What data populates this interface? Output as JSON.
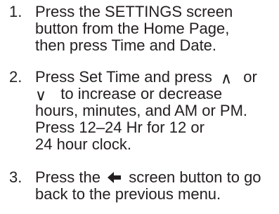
{
  "steps": [
    {
      "number": "1.",
      "lines": [
        "Press the SETTINGS screen",
        "button from the Home Page,",
        "then press Time and Date."
      ]
    },
    {
      "number": "2.",
      "line1_a": "Press Set Time and press",
      "line1_b": "or",
      "line2_b": "to increase or decrease",
      "lines_rest": [
        "hours, minutes, and AM or PM.",
        "Press 12–24 Hr for 12 or",
        "24 hour clock."
      ],
      "up_symbol": "∧",
      "down_symbol": "∨"
    },
    {
      "number": "3.",
      "line1_a": "Press the",
      "line1_b": "screen button to go",
      "line2": "back to the previous menu.",
      "back_icon": "back-arrow-icon"
    }
  ]
}
